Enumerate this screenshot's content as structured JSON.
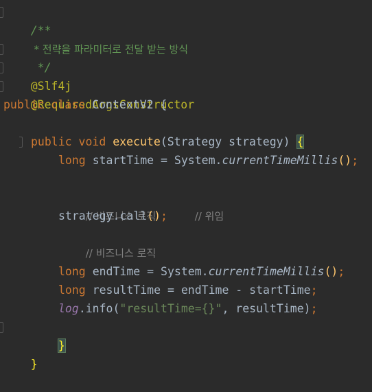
{
  "code": {
    "doc_open": "/**",
    "doc_line": " * 전략을 파라미터로 전달 받는 방식",
    "doc_close": " */",
    "anno_slf4j": "@Slf4j",
    "anno_required": "@RequiredArgsConstructor",
    "class_public": "public",
    "class_class": "class",
    "class_name": "ContextV2",
    "open_brace": "{",
    "method_public": "public",
    "method_void": "void",
    "method_name": "execute",
    "method_paren_open": "(",
    "method_param_type": "Strategy",
    "method_param_name": "strategy",
    "method_paren_close": ")",
    "method_brace": "{",
    "l1_type": "long",
    "l1_var": "startTime",
    "l1_eq": "=",
    "l1_sys": "System.",
    "l1_call": "currentTimeMillis",
    "l1_parens": "()",
    "l1_semi": ";",
    "comment_logic_1": "// 비즈니스 로직",
    "call_expr": "strategy.call",
    "call_parens": "()",
    "call_semi": ";",
    "call_comment": "// 위임",
    "comment_logic_2": "// 비즈니스 로직",
    "l2_type": "long",
    "l2_var": "endTime",
    "l2_eq": "=",
    "l2_sys": "System.",
    "l2_call": "currentTimeMillis",
    "l2_parens": "()",
    "l2_semi": ";",
    "l3_type": "long",
    "l3_var": "resultTime",
    "l3_expr": "= endTime - startTime",
    "l3_semi": ";",
    "log_obj": "log",
    "log_dot": ".info(",
    "log_str": "\"resultTime={}\"",
    "log_rest": ", resultTime)",
    "log_semi": ";",
    "method_close": "}",
    "class_close": "}"
  },
  "colors": {
    "background": "#2b2b2b",
    "keyword": "#cc7832",
    "annotation": "#bbb529",
    "doc_comment": "#629755",
    "method_name": "#ffc66d",
    "field": "#9876aa",
    "string": "#6a8759",
    "line_comment": "#808080",
    "plain": "#a9b7c6"
  }
}
